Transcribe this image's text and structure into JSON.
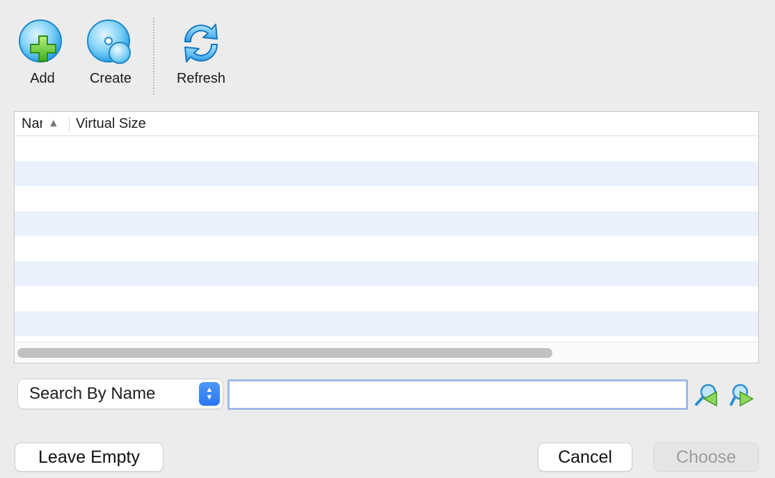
{
  "toolbar": {
    "add": {
      "label": "Add",
      "icon": "add-disk-icon"
    },
    "create": {
      "label": "Create",
      "icon": "create-disk-icon"
    },
    "refresh": {
      "label": "Refresh",
      "icon": "refresh-icon"
    }
  },
  "table": {
    "columns": [
      {
        "label": "Name",
        "sorted": "ascending"
      },
      {
        "label": "Virtual Size"
      }
    ],
    "rows": []
  },
  "search": {
    "mode_selected": "Search By Name",
    "query": "",
    "prev_icon": "search-backward-icon",
    "next_icon": "search-forward-icon"
  },
  "buttons": {
    "leave_empty": "Leave Empty",
    "cancel": "Cancel",
    "choose": "Choose",
    "choose_enabled": false
  },
  "colors": {
    "accent": "#2a76f0",
    "row_stripe": "#ebf1fc",
    "window_bg": "#ececec"
  }
}
